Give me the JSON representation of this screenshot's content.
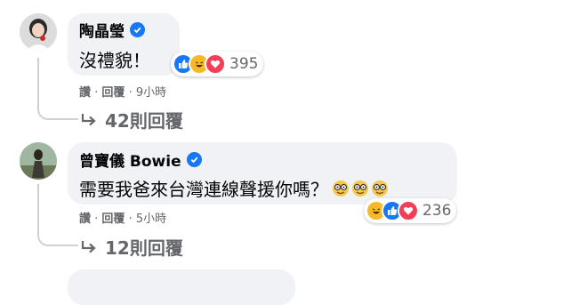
{
  "comments": [
    {
      "author": "陶晶瑩",
      "text": "沒禮貌！",
      "reaction_count": "395",
      "actions": {
        "like": "讚",
        "reply": "回覆",
        "time": "9小時"
      },
      "replies_label": "42則回覆"
    },
    {
      "author": "曾寶儀 Bowie",
      "text": "需要我爸來台灣連線聲援你嗎？",
      "reaction_count": "236",
      "actions": {
        "like": "讚",
        "reply": "回覆",
        "time": "5小時"
      },
      "replies_label": "12則回覆"
    }
  ],
  "icons": {
    "verified": "verified-badge-icon",
    "like": "like-reaction-icon",
    "haha": "haha-reaction-icon",
    "love": "love-reaction-icon",
    "nerd": "nerd-face-emoji",
    "reply_arrow": "reply-arrow-icon"
  },
  "colors": {
    "bubble": "#f0f2f5",
    "verified": "#1877f2",
    "like": "#1877f2",
    "love": "#f33e58",
    "haha": "#f7b928",
    "secondary_text": "#65676b"
  }
}
